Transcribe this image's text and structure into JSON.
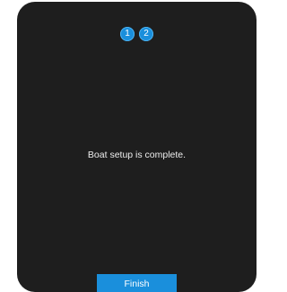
{
  "steps": [
    {
      "label": "1"
    },
    {
      "label": "2"
    }
  ],
  "message": "Boat setup is complete.",
  "finish_label": "Finish",
  "colors": {
    "panel": "#1e1e1e",
    "accent": "#1a8fdc",
    "text": "#ededed"
  }
}
